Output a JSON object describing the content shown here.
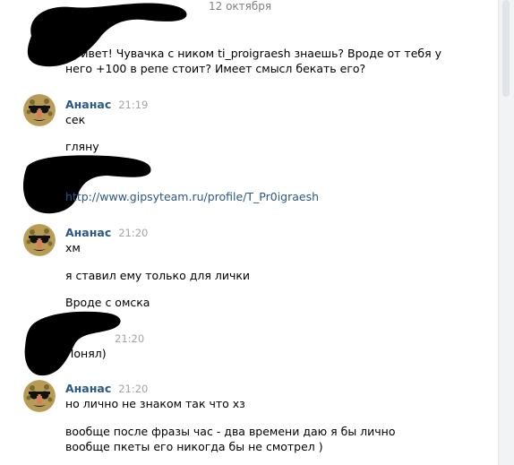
{
  "date_divider": "12 октября",
  "messages": {
    "m1": {
      "line1": "Привет! Чувачка с ником ti_proigraesh знаешь? Вроде от тебя у",
      "line2": "него +100 в репе стоит? Имеет смысл бекать его?"
    },
    "g1": {
      "name": "Ананас",
      "time": "21:19",
      "text1": "сек",
      "text2": "гляну"
    },
    "m2": {
      "link": "http://www.gipsyteam.ru/profile/T_Pr0igraesh"
    },
    "g2": {
      "name": "Ананас",
      "time": "21:20",
      "text1": "хм",
      "text2": "я ставил ему только для лички",
      "text3": "Вроде с омска"
    },
    "m3": {
      "time": "21:20",
      "text": "Понял)"
    },
    "g3": {
      "name": "Ананас",
      "time": "21:20",
      "text1": "но лично не знаком так что хз",
      "text2": "вообще после фразы час - два времени даю я бы лично",
      "text3": "вообще пкеты его никогда бы не смотрел )"
    }
  },
  "colors": {
    "name": "#2a5885",
    "time": "#a0a4a8",
    "link": "#2a5885",
    "redaction": "#000000"
  },
  "icons": {
    "avatar": "groucho-glasses-nose-avatar"
  }
}
